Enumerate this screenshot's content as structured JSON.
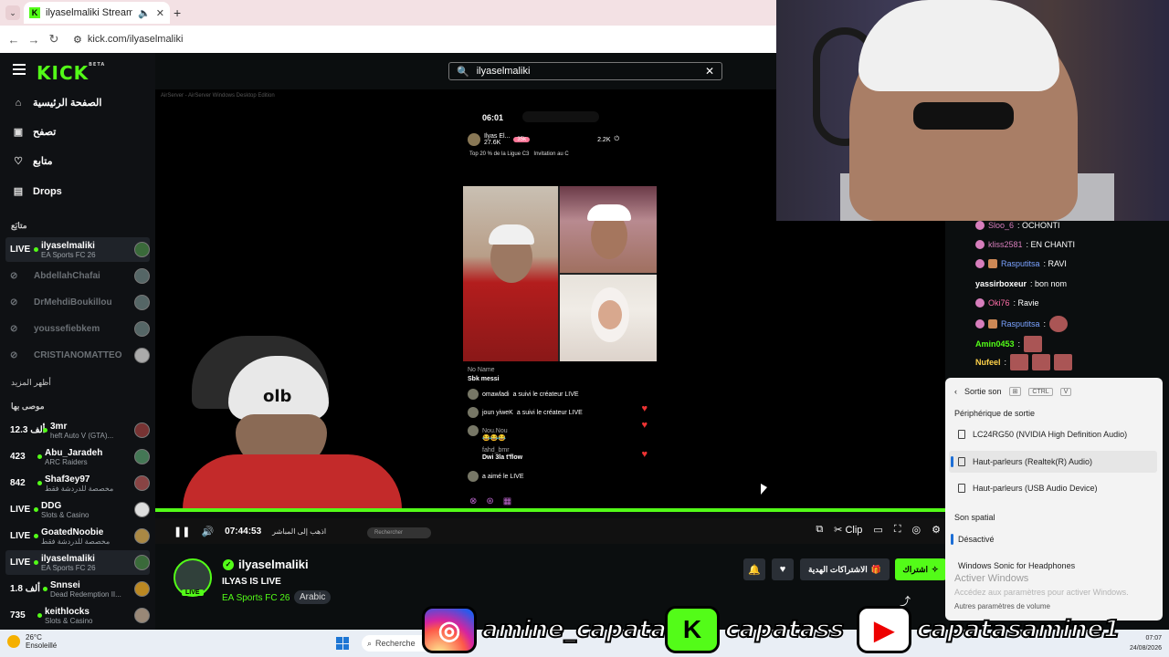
{
  "browser": {
    "tab_title": "ilyaselmaliki Stream - Watch",
    "tab_favicon": "K",
    "new_tab": "+",
    "url": "kick.com/ilyaselmaliki"
  },
  "kick": {
    "logo": "KICK",
    "logo_badge": "BETA",
    "nav": {
      "home": "الصفحة الرئيسية",
      "browse": "تصفح",
      "following": "متابع",
      "drops": "Drops"
    },
    "section_following": "متابَع",
    "following_channels": [
      {
        "live": "LIVE",
        "name": "ilyaselmaliki",
        "game": "EA Sports FC 26"
      },
      {
        "name": "AbdellahChafai"
      },
      {
        "name": "DrMehdiBoukillou"
      },
      {
        "name": "youssefiebkem"
      },
      {
        "name": "CRISTIANOMATTEO"
      }
    ],
    "show_more": "أظهر المزيد",
    "section_recommended": "موصى بها",
    "recommended_channels": [
      {
        "viewers": "12.3 ألف",
        "name": "3mr",
        "game": "heft Auto V (GTA)..."
      },
      {
        "viewers": "423",
        "name": "Abu_Jaradeh",
        "game": "ARC Raiders"
      },
      {
        "viewers": "842",
        "name": "Shaf3ey97",
        "game": "مخصصة للدردشة فقط"
      },
      {
        "live": "LIVE",
        "name": "DDG",
        "game": "Slots & Casino"
      },
      {
        "live": "LIVE",
        "name": "GoatedNoobie",
        "game": "مخصصة للدردشة فقط"
      },
      {
        "live": "LIVE",
        "name": "ilyaselmaliki",
        "game": "EA Sports FC 26"
      },
      {
        "viewers": "1.8 ألف",
        "name": "Snnsei",
        "game": "Dead Redemption II..."
      },
      {
        "viewers": "735",
        "name": "keithlocks",
        "game": "Slots & Casino"
      }
    ],
    "search_value": "ilyaselmaliki",
    "player": {
      "source_title": "AirServer - AirServer Windows Desktop Edition",
      "time": "07:44:53",
      "go_live": "اذهب إلى المباشر",
      "mini_search": "Rechercher",
      "clip": "Clip"
    },
    "channel": {
      "name": "ilyaselmaliki",
      "title": "ILYAS IS LIVE",
      "category": "EA Sports FC 26",
      "language": "Arabic",
      "live": "LIVE",
      "gift_subs": "الاشتراكات الهدية",
      "subscribe": "اشتراك"
    }
  },
  "phone": {
    "time": "06:01",
    "user": "Ilyas El...",
    "user_likes": "27.6K",
    "likes_badge": "35k",
    "viewers": "2.2K",
    "top": "Top 20 % de la Ligue C3",
    "invite": "Invitation au C",
    "comments": [
      {
        "user": "No Name",
        "text": "Sbk messi"
      },
      {
        "user": "omawladi",
        "text": "a suivi le créateur LIVE"
      },
      {
        "user": "joun yiweK",
        "text": "a suivi le créateur LIVE"
      },
      {
        "user": "Nou.Nou",
        "text": "😂😂😂"
      },
      {
        "user": "fahd_bmr",
        "text": "Dwi 3la t'flow"
      },
      {
        "user": "",
        "text": "a aimé le LIVE"
      }
    ]
  },
  "chat": [
    {
      "user": "Sloo_6",
      "text": ": OCHONTI",
      "color": "#d77ebc"
    },
    {
      "user": "kliss2581",
      "text": ": EN CHANTI",
      "color": "#d77ebc"
    },
    {
      "user": "Rasputitsa",
      "text": ": RAVI",
      "color": "#7aa2ff"
    },
    {
      "user": "yassirboxeur",
      "text": ": bon nom",
      "color": "#ffffff"
    },
    {
      "user": "Oki76",
      "text": ": Ravie",
      "color": "#ff6ea8"
    },
    {
      "user": "Rasputitsa",
      "text": ":",
      "color": "#7aa2ff"
    },
    {
      "user": "Amin0453",
      "text": ":",
      "color": "#53fc18"
    },
    {
      "user": "Nufeel",
      "text": ":",
      "color": "#ffd24a"
    }
  ],
  "sound_panel": {
    "title": "Sortie son",
    "shortcut_1": "⊞",
    "shortcut_2": "CTRL",
    "shortcut_3": "V",
    "output_device": "Périphérique de sortie",
    "devices": [
      "LC24RG50 (NVIDIA High Definition Audio)",
      "Haut-parleurs (Realtek(R) Audio)",
      "Haut-parleurs (USB Audio Device)"
    ],
    "spatial": "Son spatial",
    "spatial_options": [
      "Désactivé",
      "Windows Sonic for Headphones"
    ],
    "activate_windows": "Activer Windows",
    "activate_hint": "Accédez aux paramètres pour activer Windows.",
    "more": "Autres paramètres de volume"
  },
  "taskbar": {
    "temp": "26°C",
    "weather": "Ensoleillé",
    "search": "Recherche",
    "time": "07:07",
    "date": "24/08/2026"
  },
  "social": {
    "instagram": "amine_capatas",
    "kick": "capatass",
    "youtube": "capatasamine1"
  },
  "colors": {
    "accent": "#53fc18",
    "bg": "#0b0e0f",
    "sidebar": "#0f1114"
  }
}
